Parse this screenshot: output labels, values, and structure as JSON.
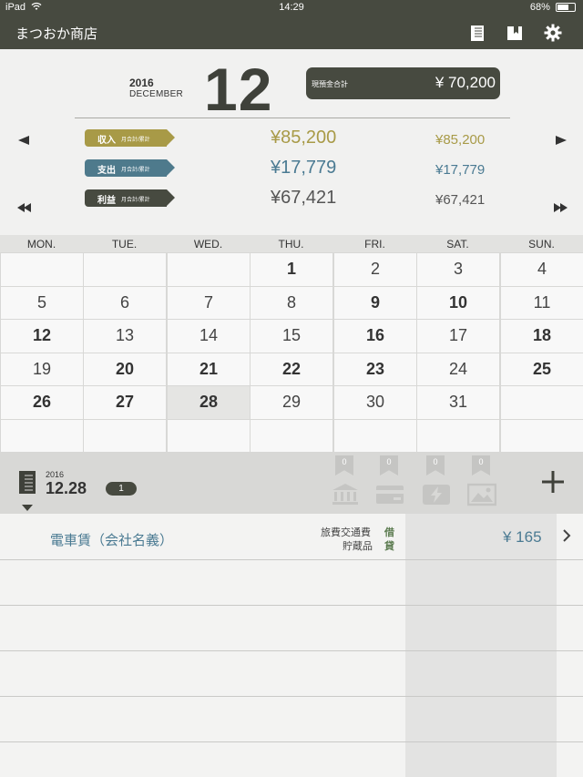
{
  "status_bar": {
    "device": "iPad",
    "time": "14:29",
    "battery": "68%",
    "battery_level": 0.68
  },
  "nav": {
    "title": "まつおか商店",
    "icons": [
      "journal-icon",
      "book-icon",
      "gear-icon"
    ]
  },
  "header": {
    "year": "2016",
    "month_en": "DECEMBER",
    "month_num": "12",
    "cash_label": "現預金合計",
    "cash_value": "¥ 70,200",
    "rows": [
      {
        "label": "収入",
        "sub": "月合計/累計",
        "monthly": "¥85,200",
        "cumulative": "¥85,200",
        "color": "#a89a47",
        "value_color": "#a89a47"
      },
      {
        "label": "支出",
        "sub": "月合計/累計",
        "monthly": "¥17,779",
        "cumulative": "¥17,779",
        "color": "#4e7a8c",
        "value_color": "#4a7a92"
      },
      {
        "label": "利益",
        "sub": "月合計/累計",
        "monthly": "¥67,421",
        "cumulative": "¥67,421",
        "color": "#474a40",
        "value_color": "#555555"
      }
    ]
  },
  "calendar": {
    "weekdays": [
      "MON.",
      "TUE.",
      "WED.",
      "THU.",
      "FRI.",
      "SAT.",
      "SUN."
    ],
    "weeks": [
      [
        "",
        "",
        "",
        "1",
        "2",
        "3",
        "4"
      ],
      [
        "5",
        "6",
        "7",
        "8",
        "9",
        "10",
        "11"
      ],
      [
        "12",
        "13",
        "14",
        "15",
        "16",
        "17",
        "18"
      ],
      [
        "19",
        "20",
        "21",
        "22",
        "23",
        "24",
        "25"
      ],
      [
        "26",
        "27",
        "28",
        "29",
        "30",
        "31",
        ""
      ],
      [
        "",
        "",
        "",
        "",
        "",
        "",
        ""
      ]
    ],
    "bold_days": [
      "1",
      "9",
      "10",
      "12",
      "16",
      "18",
      "20",
      "21",
      "22",
      "23",
      "25",
      "26",
      "27",
      "28"
    ],
    "today": "28"
  },
  "day_bar": {
    "year": "2016",
    "date": "12.28",
    "count": "1",
    "categories": [
      {
        "icon": "bank-icon",
        "badge": "0"
      },
      {
        "icon": "card-icon",
        "badge": "0"
      },
      {
        "icon": "lightning-icon",
        "badge": "0"
      },
      {
        "icon": "image-icon",
        "badge": "0"
      }
    ]
  },
  "entries": [
    {
      "title": "電車賃（会社名義）",
      "debit_account": "旅費交通費",
      "debit_mark": "借",
      "credit_account": "貯蔵品",
      "credit_mark": "貸",
      "amount": "¥ 165"
    }
  ]
}
